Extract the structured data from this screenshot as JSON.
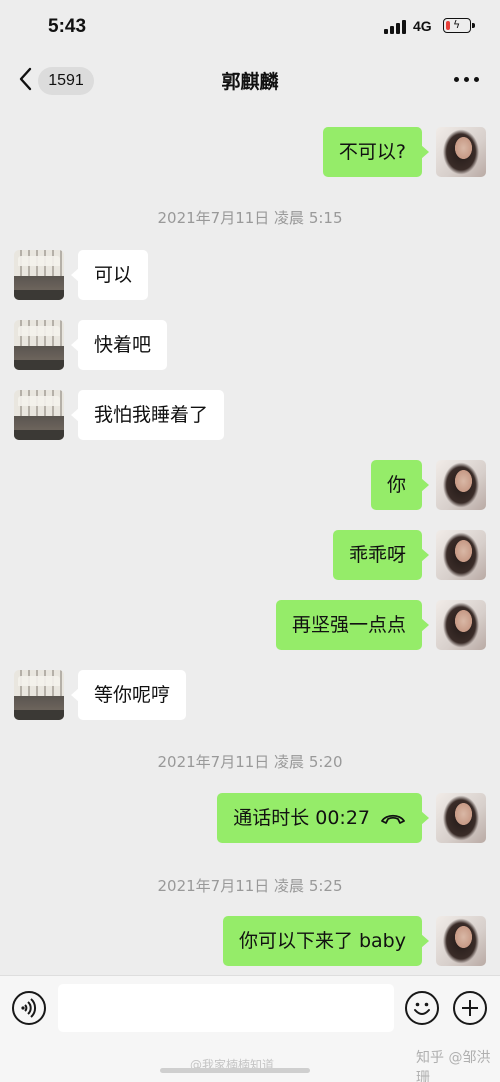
{
  "status_bar": {
    "time": "5:43",
    "network": "4G",
    "battery_level": 0.2
  },
  "header": {
    "back_icon": "chevron-left-icon",
    "unread_count": "1591",
    "title": "郭麒麟",
    "more_icon": "ellipsis-icon"
  },
  "messages": [
    {
      "type": "text",
      "direction": "out",
      "text": "不可以?"
    },
    {
      "type": "time",
      "text": "2021年7月11日 凌晨 5:15"
    },
    {
      "type": "text",
      "direction": "in",
      "text": "可以"
    },
    {
      "type": "text",
      "direction": "in",
      "text": "快着吧"
    },
    {
      "type": "text",
      "direction": "in",
      "text": "我怕我睡着了"
    },
    {
      "type": "text",
      "direction": "out",
      "text": "你"
    },
    {
      "type": "text",
      "direction": "out",
      "text": "乖乖呀"
    },
    {
      "type": "text",
      "direction": "out",
      "text": "再坚强一点点"
    },
    {
      "type": "text",
      "direction": "in",
      "text": "等你呢哼"
    },
    {
      "type": "time",
      "text": "2021年7月11日 凌晨 5:20"
    },
    {
      "type": "call",
      "direction": "out",
      "text": "通话时长 00:27",
      "icon": "phone-hangup-icon"
    },
    {
      "type": "time",
      "text": "2021年7月11日 凌晨 5:25"
    },
    {
      "type": "text",
      "direction": "out",
      "text": "你可以下来了 baby"
    }
  ],
  "input_bar": {
    "voice_icon": "voice-icon",
    "emoji_icon": "emoji-icon",
    "plus_icon": "plus-icon",
    "input_value": ""
  },
  "watermark": "知乎 @邹洪珊",
  "bottom_watermark": "@我家楠楠知道"
}
